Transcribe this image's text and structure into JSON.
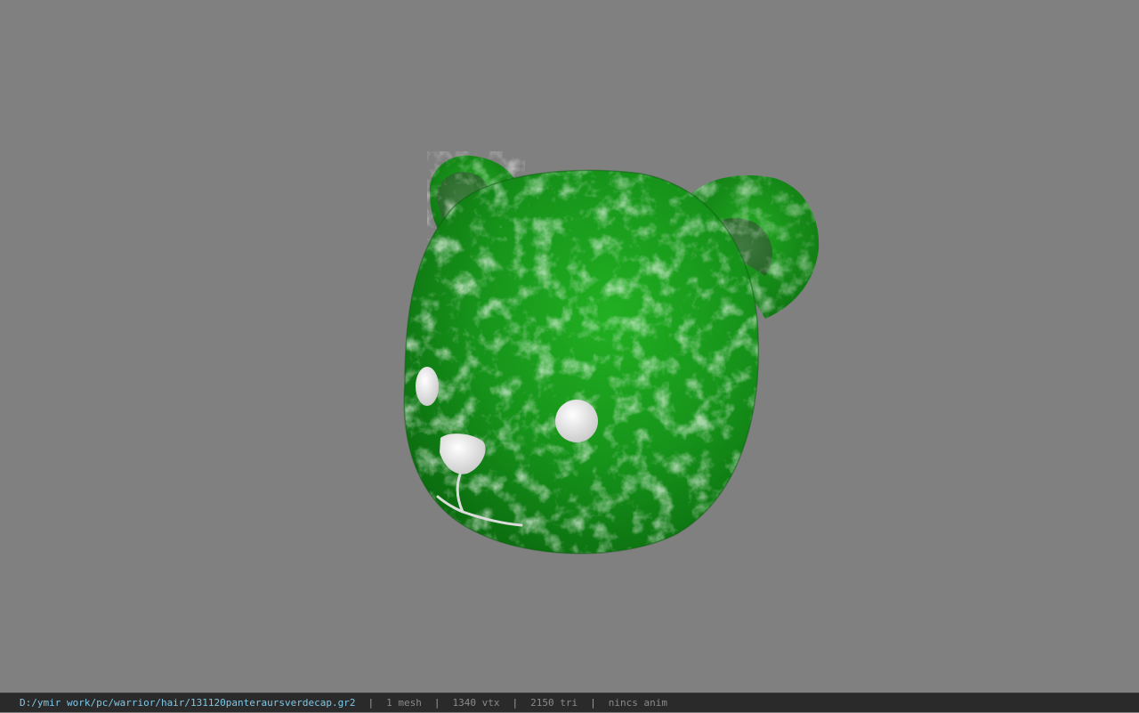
{
  "viewer": {
    "background_color": "#808080",
    "model": {
      "name": "bear-head-cap",
      "texture_color": "#1f9a1f",
      "highlight_color": "#e8f0e8"
    }
  },
  "status_bar": {
    "file_path": "D:/ymir work/pc/warrior/hair/131120panteraursverdecap.gr2",
    "separator": "|",
    "mesh_count": "1 mesh",
    "vertex_count": "1340 vtx",
    "triangle_count": "2150 tri",
    "anim_status": "nincs anim"
  }
}
